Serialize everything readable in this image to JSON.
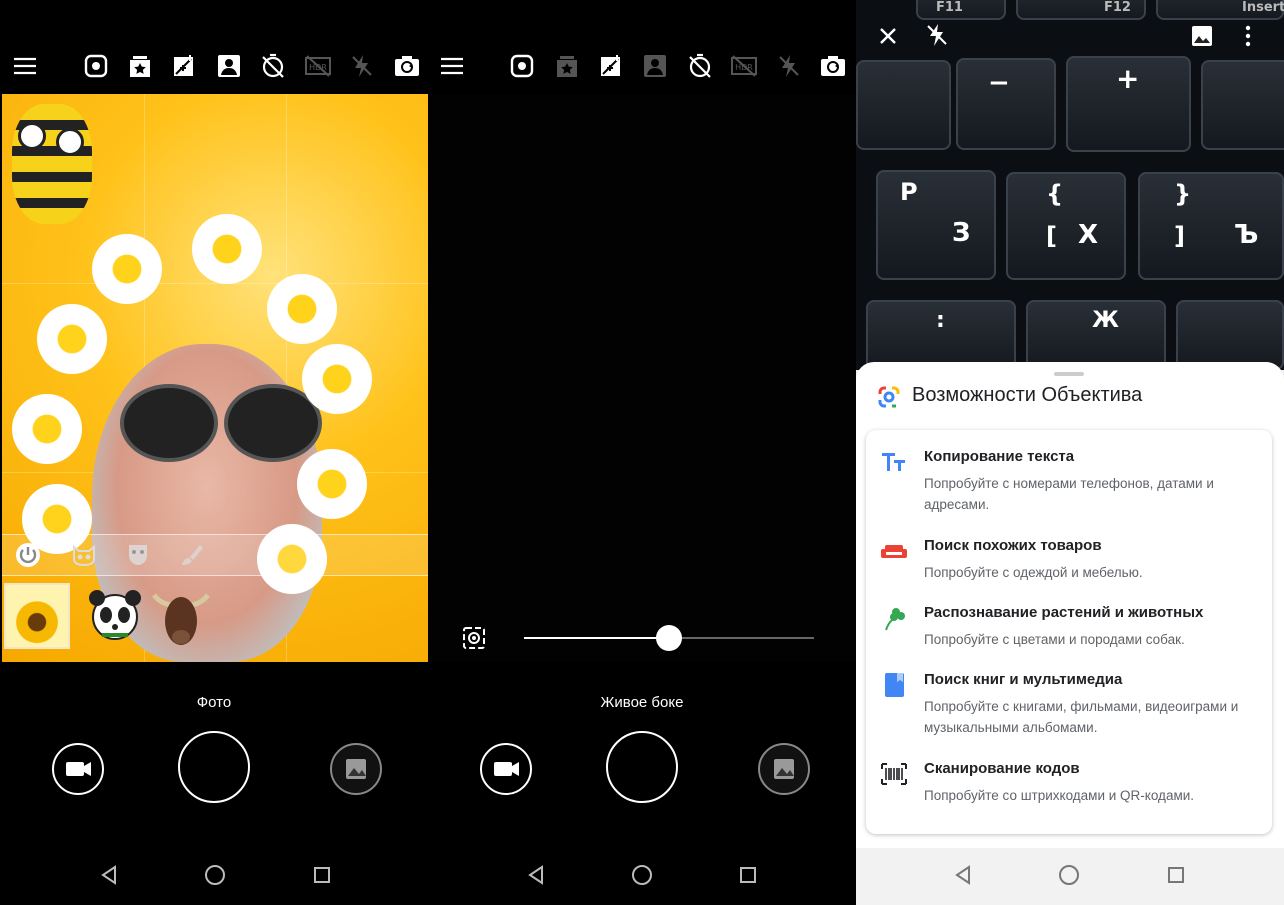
{
  "colors": {
    "accent_blue": "#4285f4",
    "accent_red": "#ea4335",
    "accent_green": "#34a853",
    "accent_yellow": "#fbbc04",
    "background": "#000000",
    "sheet_background": "#ffffff"
  },
  "screen_photo": {
    "mode_label": "Фото",
    "toolbar_icons": [
      "menu-icon",
      "focus-icon",
      "sticker-star-icon",
      "sparkle-icon",
      "portrait-icon",
      "timer-off-icon",
      "hdr-icon",
      "flash-off-icon",
      "switch-camera-icon"
    ],
    "filter_icons": [
      "power-icon",
      "cat-mask-icon",
      "theater-mask-icon",
      "brush-icon"
    ],
    "stickers": [
      "bee-sunflower-sticker",
      "panda-sticker",
      "bull-sticker"
    ]
  },
  "screen_bokeh": {
    "mode_label": "Живое боке",
    "toolbar_icons": [
      "menu-icon",
      "focus-icon",
      "sticker-star-icon",
      "sparkle-icon",
      "portrait-icon",
      "timer-off-icon",
      "hdr-icon",
      "flash-off-icon",
      "switch-camera-icon"
    ],
    "blur_level": 0.5
  },
  "screen_lens": {
    "keyboard_keys": [
      "F11",
      "F12",
      "Insert",
      "−",
      "+",
      "Р",
      "З",
      "{",
      "[",
      "Х",
      "}",
      "]",
      "Ъ",
      "Ж",
      ":"
    ],
    "sheet_title": "Возможности Объектива",
    "features": [
      {
        "icon": "text-icon",
        "title": "Копирование текста",
        "subtitle": "Попробуйте с номерами телефонов, датами и адресами."
      },
      {
        "icon": "sofa-icon",
        "title": "Поиск похожих товаров",
        "subtitle": "Попробуйте с одеждой и мебелью."
      },
      {
        "icon": "leaf-icon",
        "title": "Распознавание растений и животных",
        "subtitle": "Попробуйте с цветами и породами собак."
      },
      {
        "icon": "book-icon",
        "title": "Поиск книг и мультимедиа",
        "subtitle": "Попробуйте с книгами, фильмами, видеоиграми и музыкальными альбомами."
      },
      {
        "icon": "barcode-icon",
        "title": "Сканирование кодов",
        "subtitle": "Попробуйте со штрихкодами и QR-кодами."
      }
    ]
  }
}
